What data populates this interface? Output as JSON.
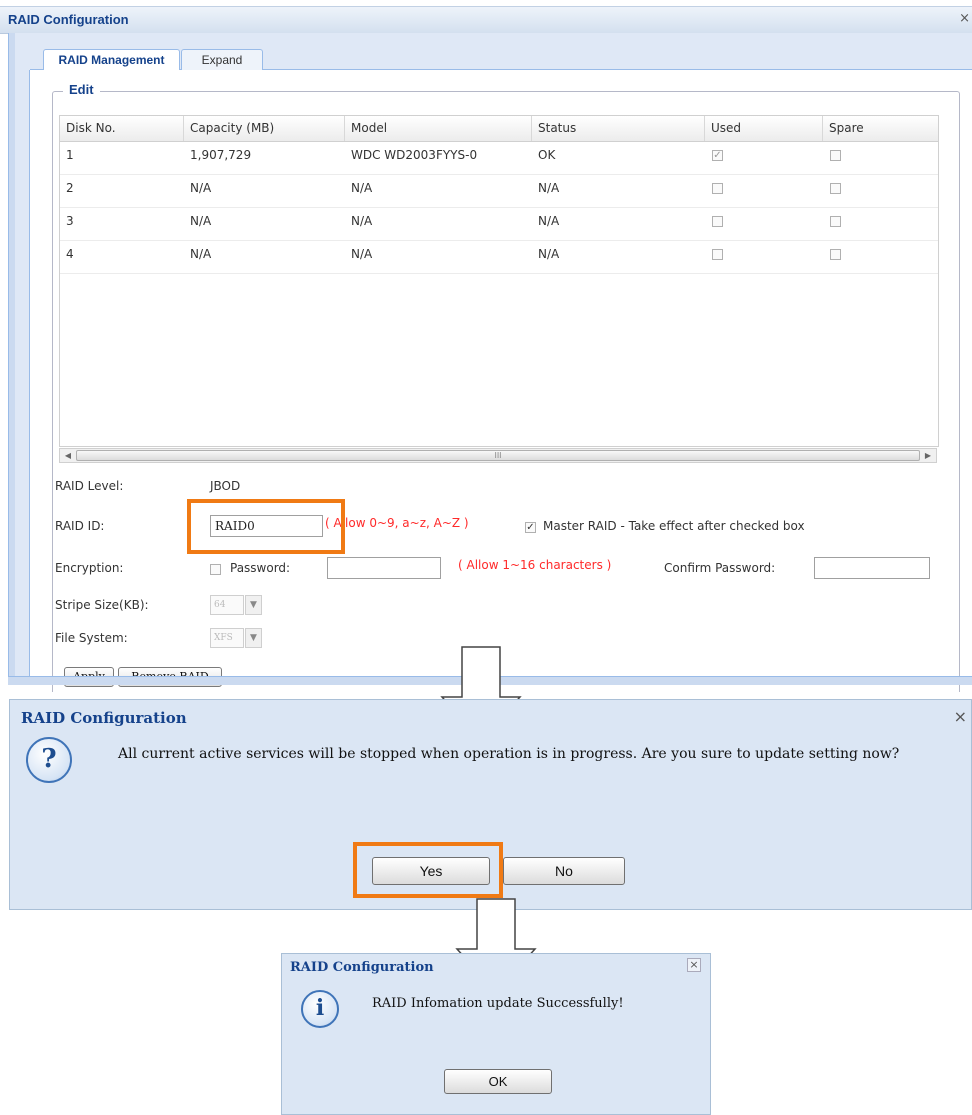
{
  "raid_window": {
    "title": "RAID Configuration",
    "close_glyph": "×",
    "tabs": [
      "RAID Management",
      "Expand"
    ],
    "fieldset_legend": "Edit",
    "columns": [
      "Disk No.",
      "Capacity (MB)",
      "Model",
      "Status",
      "Used",
      "Spare"
    ],
    "disks": [
      {
        "disk_no": "1",
        "capacity": "1,907,729",
        "model": "WDC WD2003FYYS-0",
        "status": "OK",
        "used": true,
        "spare": false
      },
      {
        "disk_no": "2",
        "capacity": "N/A",
        "model": "N/A",
        "status": "N/A",
        "used": false,
        "spare": false
      },
      {
        "disk_no": "3",
        "capacity": "N/A",
        "model": "N/A",
        "status": "N/A",
        "used": false,
        "spare": false
      },
      {
        "disk_no": "4",
        "capacity": "N/A",
        "model": "N/A",
        "status": "N/A",
        "used": false,
        "spare": false
      }
    ],
    "raid_level_label": "RAID Level:",
    "raid_level_value": "JBOD",
    "raid_id_label": "RAID ID:",
    "raid_id_value": "RAID0",
    "raid_id_hint": "( Allow 0~9, a~z, A~Z )",
    "master_raid_checked": true,
    "master_raid_label": "Master RAID - Take effect after checked box",
    "encryption_label": "Encryption:",
    "encryption_checked": false,
    "password_label": "Password:",
    "password_value": "",
    "password_hint": "( Allow 1~16 characters )",
    "confirm_password_label": "Confirm Password:",
    "confirm_password_value": "",
    "stripe_size_label": "Stripe Size(KB):",
    "stripe_size_value": "64",
    "file_system_label": "File System:",
    "file_system_value": "XFS",
    "apply_button": "Apply",
    "remove_button": "Remove RAID",
    "scroll_left_glyph": "◀",
    "scroll_right_glyph": "▶",
    "scroll_grip_glyph": "III",
    "combo_arrow_glyph": "▼",
    "checkmark_glyph": "✓"
  },
  "confirm_dialog": {
    "title": "RAID Configuration",
    "close_glyph": "×",
    "icon_glyph": "?",
    "message": "All current active services will be stopped when operation is in progress. Are you sure to update setting now?",
    "yes_button": "Yes",
    "no_button": "No"
  },
  "success_dialog": {
    "title": "RAID Configuration",
    "close_glyph": "×",
    "icon_glyph": "i",
    "message": "RAID Infomation update Successfully!",
    "ok_button": "OK"
  },
  "colors": {
    "highlight": "#f07a14",
    "title_text": "#15428b",
    "hint_red": "#ff2a2a",
    "dialog_bg": "#dbe6f4",
    "panel_bg": "#dfe8f6"
  },
  "icons": {
    "confirm_icon": "question-icon",
    "success_icon": "info-icon",
    "flow_arrow": "down-arrow-icon"
  }
}
